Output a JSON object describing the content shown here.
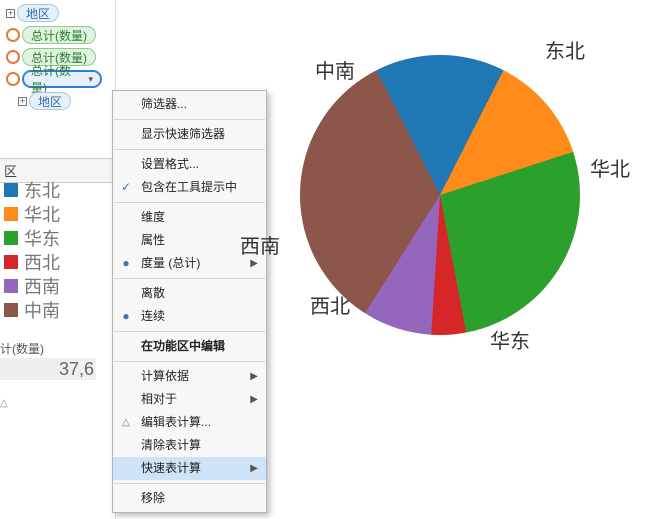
{
  "shelf": {
    "dimension_label": "地区",
    "measure_label": "总计(数量)"
  },
  "legend": {
    "title": "区",
    "items": [
      {
        "label": "东北",
        "color": "#1F77B4"
      },
      {
        "label": "华北",
        "color": "#FF8C1A"
      },
      {
        "label": "华东",
        "color": "#2CA02C"
      },
      {
        "label": "西北",
        "color": "#D62728"
      },
      {
        "label": "西南",
        "color": "#9467BD"
      },
      {
        "label": "中南",
        "color": "#8C564B"
      }
    ]
  },
  "readout": {
    "label": "计(数量)",
    "value": "37,6"
  },
  "context_menu": {
    "filter": "筛选器...",
    "show_quick_filter": "显示快速筛选器",
    "format": "设置格式...",
    "include_tooltip": "包含在工具提示中",
    "dimension": "维度",
    "attribute": "属性",
    "measure_total": "度量 (总计)",
    "discrete": "离散",
    "continuous": "连续",
    "edit_in_shelf": "在功能区中编辑",
    "compute_using": "计算依据",
    "relative_to": "相对于",
    "edit_table_calc": "编辑表计算...",
    "clear_table_calc": "清除表计算",
    "quick_table_calc": "快速表计算",
    "remove": "移除"
  },
  "chart_data": {
    "type": "pie",
    "title": "",
    "series": [
      {
        "name": "东北",
        "value": 15.0,
        "color": "#1F77B4"
      },
      {
        "name": "华北",
        "value": 12.5,
        "color": "#FF8C1A"
      },
      {
        "name": "华东",
        "value": 27.0,
        "color": "#2CA02C"
      },
      {
        "name": "西北",
        "value": 4.0,
        "color": "#D62728"
      },
      {
        "name": "西南",
        "value": 8.0,
        "color": "#9467BD"
      },
      {
        "name": "中南",
        "value": 33.5,
        "color": "#8C564B"
      }
    ]
  }
}
